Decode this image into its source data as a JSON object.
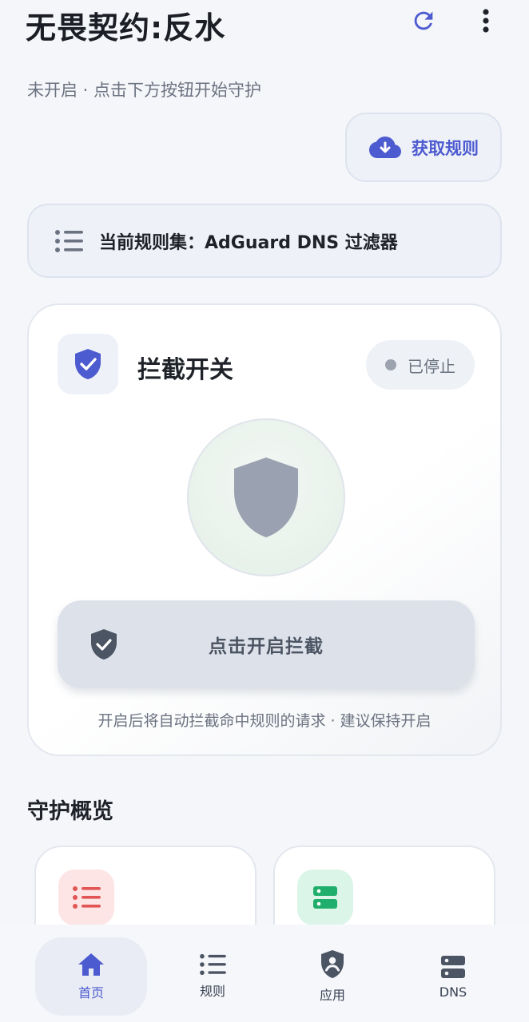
{
  "app": {
    "title": "无畏契约:反水",
    "subtitle": "未开启 · 点击下方按钮开始守护"
  },
  "header": {
    "refresh_icon": "refresh-icon",
    "more_icon": "more-vert-icon"
  },
  "fetch_rules": {
    "label": "获取规则",
    "icon": "cloud-download-icon"
  },
  "ruleset": {
    "label": "当前规则集：AdGuard DNS 过滤器",
    "icon": "list-icon"
  },
  "blocking_card": {
    "title": "拦截开关",
    "status": "已停止",
    "button_label": "点击开启拦截",
    "hint": "开启后将自动拦截命中规则的请求 · 建议保持开启"
  },
  "overview": {
    "title": "守护概览"
  },
  "nav": {
    "items": [
      {
        "label": "首页",
        "icon": "home-icon"
      },
      {
        "label": "规则",
        "icon": "list-icon"
      },
      {
        "label": "应用",
        "icon": "app-shield-icon"
      },
      {
        "label": "DNS",
        "icon": "dns-server-icon"
      }
    ]
  },
  "colors": {
    "accent": "#4d5bd0",
    "background": "#f5f6fa",
    "shield_inactive": "#9aa1b0",
    "stat_red": "#e25555",
    "stat_green": "#1fae6b"
  }
}
